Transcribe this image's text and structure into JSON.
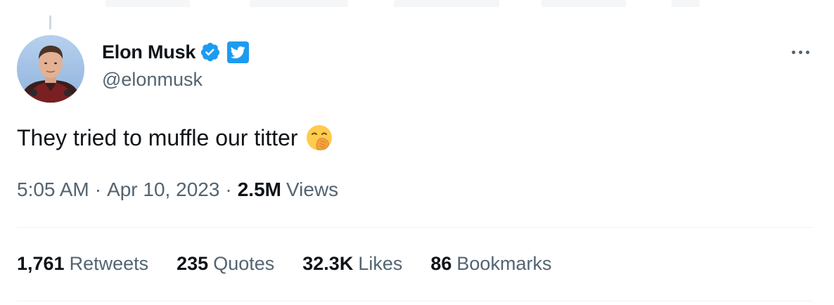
{
  "author": {
    "display_name": "Elon Musk",
    "handle": "@elonmusk"
  },
  "tweet": {
    "text": "They tried to muffle our titter",
    "emoji": "face-with-hand-over-mouth"
  },
  "meta": {
    "time": "5:05 AM",
    "separator": "·",
    "date": "Apr 10, 2023",
    "views_count": "2.5M",
    "views_label": "Views"
  },
  "stats": [
    {
      "count": "1,761",
      "label": "Retweets"
    },
    {
      "count": "235",
      "label": "Quotes"
    },
    {
      "count": "32.3K",
      "label": "Likes"
    },
    {
      "count": "86",
      "label": "Bookmarks"
    }
  ],
  "colors": {
    "text_primary": "#0f1419",
    "text_secondary": "#536471",
    "accent": "#1d9bf0",
    "divider": "#eff3f4"
  },
  "icons": {
    "verified": "verified-badge-icon",
    "affiliate": "twitter-bird-icon",
    "more": "more-horizontal-icon"
  }
}
